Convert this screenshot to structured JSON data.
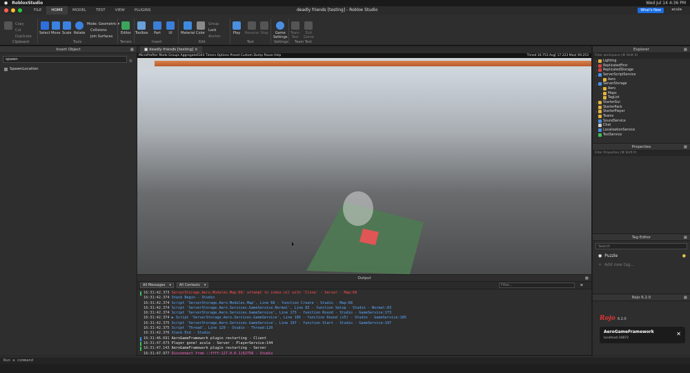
{
  "menubar": {
    "app_name": "RobloxStudio",
    "datetime": "Wed Jul 14  4:36 PM"
  },
  "titlebar": {
    "file_label": "FILE",
    "tabs": [
      "HOME",
      "MODEL",
      "TEST",
      "VIEW",
      "PLUGINS"
    ],
    "window_title": "deadly friends [testing] - Roblox Studio",
    "whats_new": "What's New",
    "user": "acula"
  },
  "ribbon": {
    "clipboard": {
      "copy": "Copy",
      "cut": "Cut",
      "duplicate": "Duplicate",
      "group": "Clipboard"
    },
    "tools": {
      "select": "Select",
      "move": "Move",
      "scale": "Scale",
      "rotate": "Rotate",
      "mode": "Mode:",
      "mode_value": "Geometric",
      "collisions": "Collisions",
      "join_surfaces": "Join Surfaces",
      "group": "Tools"
    },
    "terrain": {
      "editor": "Editor",
      "group": "Terrain"
    },
    "insert": {
      "toolbox": "Toolbox",
      "part": "Part",
      "ui": "UI",
      "group": "Insert"
    },
    "edit": {
      "material": "Material",
      "color": "Color",
      "group_btn": "Group",
      "lock": "Lock",
      "anchor": "Anchor",
      "group": "Edit"
    },
    "test": {
      "play": "Play",
      "resume": "Resume",
      "stop": "Stop",
      "group": "Test"
    },
    "settings": {
      "game_settings_1": "Game",
      "game_settings_2": "Settings",
      "group": "Settings"
    },
    "team_test": {
      "team": "Team",
      "test": "Test",
      "exit": "Exit",
      "game": "Game",
      "group": "Team Test"
    }
  },
  "insert_object": {
    "title": "Insert Object",
    "search_value": "spawn",
    "items": [
      {
        "label": "SpawnLocation"
      }
    ]
  },
  "viewport": {
    "tab_label": "deadly friends [testing]",
    "menu_text": "MicroProfiler   Mode Groups Aggregate6343 Timers Options Preset Custom Dump Pause Help",
    "timing_text": "Timed  16.753  Avg[  17.223  Max[  69.253"
  },
  "output": {
    "title": "Output",
    "filter_messages": "All Messages",
    "filter_contexts": "All Contexts",
    "search_placeholder": "Filter...",
    "lines": [
      {
        "time": "16:31:42.373",
        "text": "ServerStorage.Aero.Modules.Map:68: attempt to index nil with 'Clone'  -  Server - Map:68",
        "color": "red",
        "marker": "#3cbf5a"
      },
      {
        "time": "16:31:42.374",
        "text": "Stack Begin  -  Studio",
        "color": "blue",
        "marker": ""
      },
      {
        "time": "16:31:42.374",
        "text": "Script 'ServerStorage.Aero.Modules.Map', Line 68 - function Create  -  Studio - Map:68",
        "color": "blue",
        "marker": ""
      },
      {
        "time": "16:31:42.374",
        "text": "Script 'ServerStorage.Aero.Services.GameService.Normal', Line 83 - function Setup  -  Studio - Normal:83",
        "color": "blue",
        "marker": ""
      },
      {
        "time": "16:31:42.374",
        "text": "Script 'ServerStorage.Aero.Services.GameService', Line 173 - function Round  -  Studio - GameService:173",
        "color": "blue",
        "marker": ""
      },
      {
        "time": "16:31:42.374",
        "text": "▶ Script 'ServerStorage.Aero.Services.GameService', Line 185 - function Round (x5)  -  Studio - GameService:185",
        "color": "blue",
        "marker": ""
      },
      {
        "time": "16:31:42.375",
        "text": "Script 'ServerStorage.Aero.Services.GameService', Line 197 - function Start  -  Studio - GameService:197",
        "color": "blue",
        "marker": ""
      },
      {
        "time": "16:31:42.375",
        "text": "Script 'Thread', Line 120  -  Studio - Thread:120",
        "color": "blue",
        "marker": ""
      },
      {
        "time": "16:31:42.376",
        "text": "Stack End  -  Studio",
        "color": "blue",
        "marker": ""
      },
      {
        "time": "16:31:46.691",
        "text": "AeroGameFramework plugin restarting  -  Client",
        "color": "white",
        "marker": "#3c8fe0"
      },
      {
        "time": "16:31:47.073",
        "text": "Player gone! acula  -  Server - PlayerService:144",
        "color": "white",
        "marker": "#3cbf5a"
      },
      {
        "time": "16:31:47.143",
        "text": "AeroGameFramework plugin restarting  -  Server",
        "color": "white",
        "marker": "#3cbf5a"
      },
      {
        "time": "16:31:47.977",
        "text": "Disconnect from ::ffff:127.0.0.1|62758  -  Studio",
        "color": "pink",
        "marker": ""
      }
    ]
  },
  "explorer": {
    "title": "Explorer",
    "filter_placeholder": "Filter workspace (⌘ Shift X)",
    "items": [
      {
        "label": "Lighting",
        "indent": 0,
        "arrow": "›",
        "color": "#e0b13d"
      },
      {
        "label": "ReplicatedFirst",
        "indent": 0,
        "arrow": "›",
        "color": "#d2423d"
      },
      {
        "label": "ReplicatedStorage",
        "indent": 0,
        "arrow": "›",
        "color": "#d2423d"
      },
      {
        "label": "ServerScriptService",
        "indent": 0,
        "arrow": "⌄",
        "color": "#4a8fe0"
      },
      {
        "label": "Aero",
        "indent": 1,
        "arrow": "",
        "color": "#e0b13d"
      },
      {
        "label": "ServerStorage",
        "indent": 0,
        "arrow": "⌄",
        "color": "#4a8fe0"
      },
      {
        "label": "Aero",
        "indent": 1,
        "arrow": "›",
        "color": "#e0b13d"
      },
      {
        "label": "Maps",
        "indent": 1,
        "arrow": "›",
        "color": "#e0b13d"
      },
      {
        "label": "TagList",
        "indent": 1,
        "arrow": "",
        "color": "#e0b13d"
      },
      {
        "label": "StarterGui",
        "indent": 0,
        "arrow": "›",
        "color": "#e0b13d"
      },
      {
        "label": "StarterPack",
        "indent": 0,
        "arrow": "",
        "color": "#e0b13d"
      },
      {
        "label": "StarterPlayer",
        "indent": 0,
        "arrow": "›",
        "color": "#e0b13d"
      },
      {
        "label": "Teams",
        "indent": 0,
        "arrow": "",
        "color": "#e0b13d"
      },
      {
        "label": "SoundService",
        "indent": 0,
        "arrow": "",
        "color": "#4a8fe0"
      },
      {
        "label": "Chat",
        "indent": 0,
        "arrow": "",
        "color": "#cfcfcf"
      },
      {
        "label": "LocalizationService",
        "indent": 0,
        "arrow": "",
        "color": "#4a8fe0"
      },
      {
        "label": "TestService",
        "indent": 0,
        "arrow": "",
        "color": "#3cbf5a"
      }
    ]
  },
  "properties": {
    "title": "Properties",
    "filter_placeholder": "Filter Properties (⌘ Shift P)"
  },
  "tag_editor": {
    "title": "Tag Editor",
    "search_placeholder": "Search",
    "tags": [
      {
        "label": "Puzzle"
      }
    ],
    "add_label": "Add new tag..."
  },
  "rojo": {
    "title": "Rojo 6.2.0",
    "logo": "Rojo",
    "version": "6.2.0",
    "project": "AeroGameFramework",
    "address": "localhost:34872",
    "close": "✕"
  },
  "command_bar": {
    "placeholder": "Run a command"
  }
}
